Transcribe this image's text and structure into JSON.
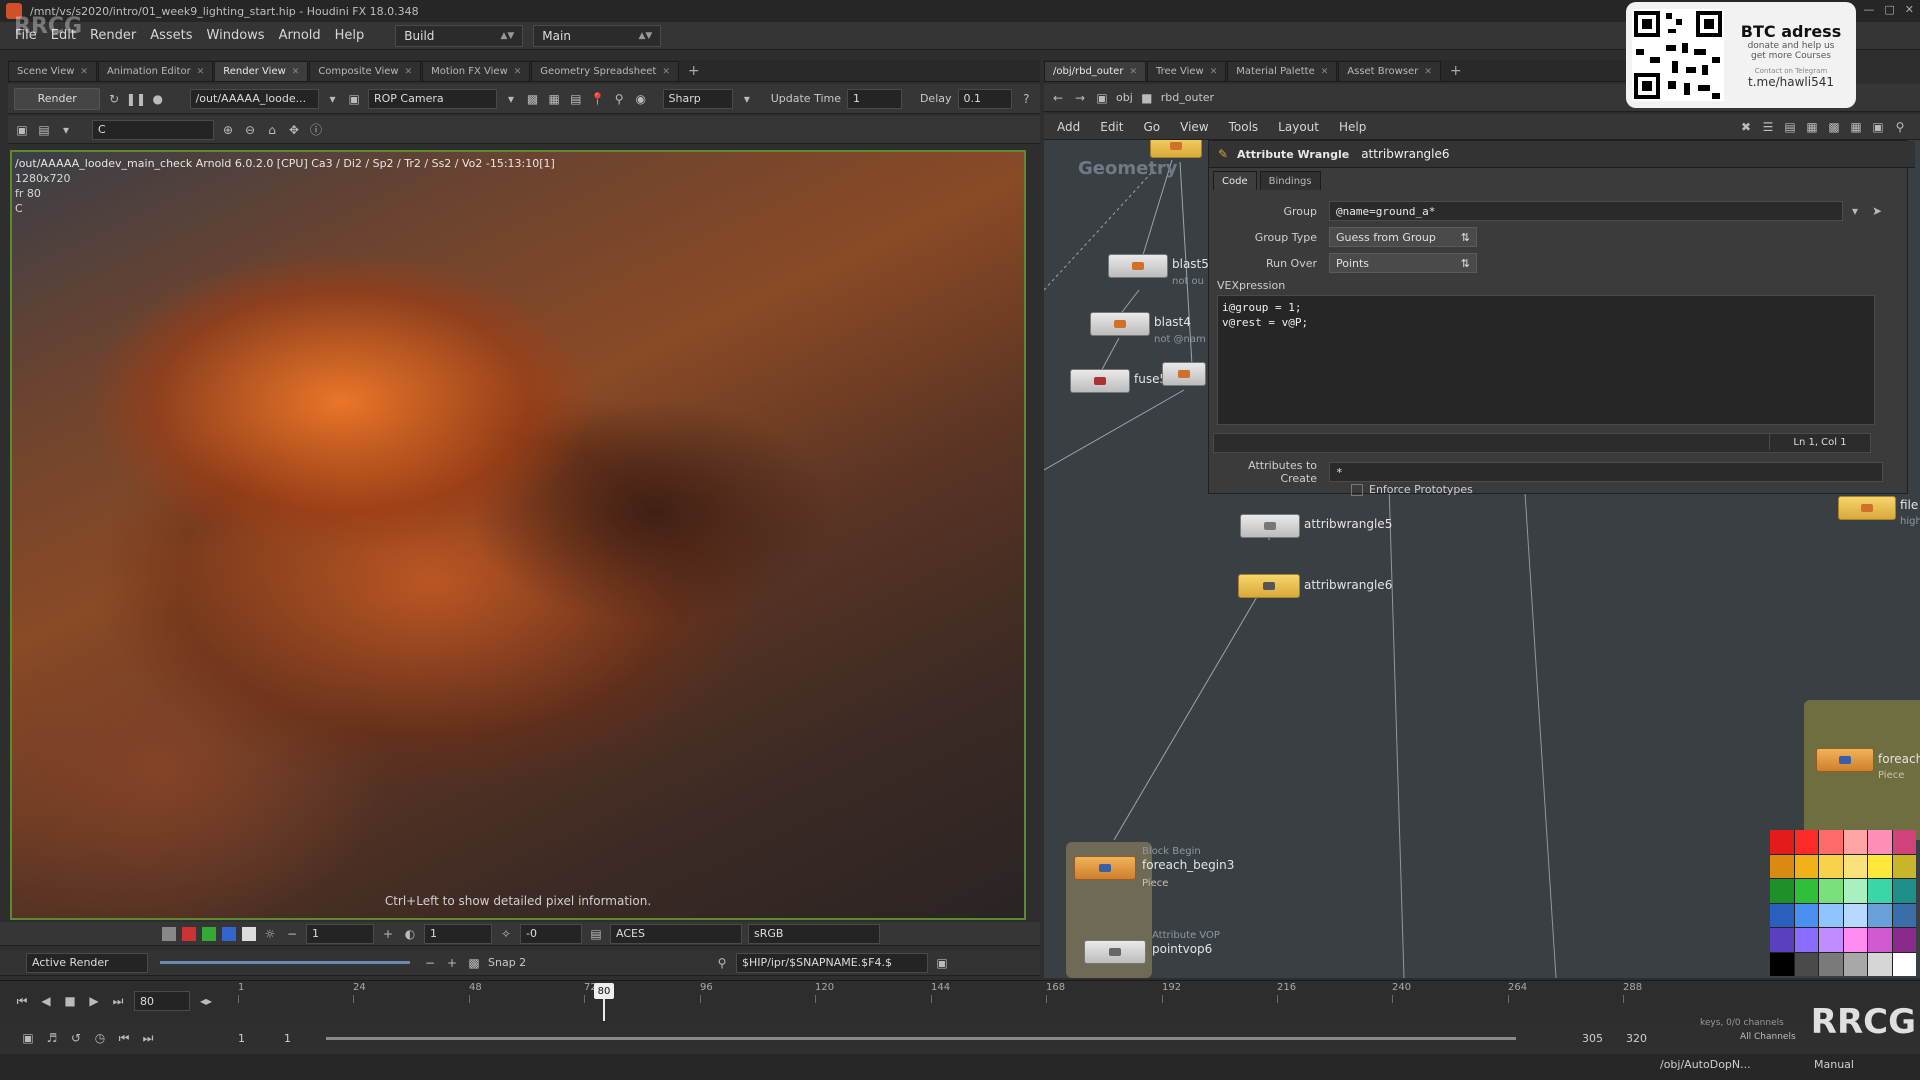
{
  "app": {
    "window_title": "/mnt/vs/s2020/intro/01_week9_lighting_start.hip - Houdini FX 18.0.348",
    "watermark": "RRCG"
  },
  "menubar": {
    "items": [
      "File",
      "Edit",
      "Render",
      "Assets",
      "Windows",
      "Arnold",
      "Help"
    ],
    "shelf_set": "Build",
    "desktop": "Main"
  },
  "left_tabs": [
    "Scene View",
    "Animation Editor",
    "Render View",
    "Composite View",
    "Motion FX View",
    "Geometry Spreadsheet"
  ],
  "left_tabs_active": 2,
  "render_toolbar": {
    "render_label": "Render",
    "output_path": "/out/AAAAA_loode...",
    "camera": "ROP Camera",
    "filter": "Sharp",
    "update_time_label": "Update Time",
    "update_time_value": "1",
    "delay_label": "Delay",
    "delay_value": "0.1"
  },
  "render_toolbar2": {
    "aov": "C"
  },
  "viewport": {
    "header": "/out/AAAAA_loodev_main_check  Arnold 6.0.2.0 [CPU]  Ca3 / Di2 / Sp2 / Tr2 / Ss2 / Vo2 -15:13:10[1]",
    "resolution": "1280x720",
    "frame": "fr 80",
    "channel": "C",
    "hint": "Ctrl+Left to show detailed pixel information."
  },
  "viewport_bar": {
    "exposure": "1",
    "gamma": "1",
    "offset": "-0",
    "ocio": "ACES",
    "display": "sRGB"
  },
  "render_bar": {
    "active_render": "Active Render",
    "snap_label": "Snap 2",
    "snap_path": "$HIP/ipr/$SNAPNAME.$F4.$"
  },
  "right_tabs": [
    "/obj/rbd_outer",
    "Tree View",
    "Material Palette",
    "Asset Browser"
  ],
  "right_tabs_active": 0,
  "net_path": {
    "root": "obj",
    "current": "rbd_outer"
  },
  "net_menu": [
    "Add",
    "Edit",
    "Go",
    "View",
    "Tools",
    "Layout",
    "Help"
  ],
  "params": {
    "node_type": "Attribute Wrangle",
    "node_name": "attribwrangle6",
    "tabs": [
      "Code",
      "Bindings"
    ],
    "group_label": "Group",
    "group_value": "@name=ground_a*",
    "group_type_label": "Group Type",
    "group_type_value": "Guess from Group",
    "run_over_label": "Run Over",
    "run_over_value": "Points",
    "vex_label": "VEXpression",
    "vex_code": "i@group = 1;\nv@rest = v@P;",
    "cursor_pos": "Ln 1, Col 1",
    "attrs_label": "Attributes to Create",
    "attrs_value": "*",
    "enforce_label": "Enforce Prototypes"
  },
  "nodes": {
    "geometry_label": "Geometry",
    "blast5": "blast5",
    "blast5_sub": "not ou",
    "blast4": "blast4",
    "blast4_sub": "not @nam",
    "fuse5": "fuse5",
    "attribwrangle5": "attribwrangle5",
    "attribwrangle6": "attribwrangle6",
    "foreach_begin3": "foreach_begin3",
    "foreach_begin3_tag": "Block Begin",
    "foreach_begin3_sub": "Piece",
    "pointvop6": "pointvop6",
    "pointvop6_tag": "Attribute VOP",
    "foreach_right": "foreach",
    "foreach_right_sub": "Piece",
    "file_right": "file",
    "file_right_sub": "high"
  },
  "banner": {
    "title": "BTC adress",
    "line1": "donate and help us",
    "line2": "get more Courses",
    "line3": "Contact on Telegram",
    "handle": "t.me/hawli541"
  },
  "timeline": {
    "current_frame": "80",
    "frame_field": "80",
    "ticks": [
      "1",
      "24",
      "48",
      "72",
      "96",
      "120",
      "144",
      "168",
      "192",
      "216",
      "240",
      "264",
      "288"
    ],
    "start": "1",
    "start2": "1",
    "end": "305",
    "end2": "320"
  },
  "statusbar": {
    "path": "/obj/AutoDopN...",
    "mode": "Manual",
    "keys_label": "keys, 0/0 channels",
    "all_channels": "All Channels"
  },
  "palette_colors": [
    "#e51b1b",
    "#ff2a2a",
    "#ff6b6b",
    "#ffa5a5",
    "#ff8fb8",
    "#d0437a",
    "#d88a12",
    "#f2b01a",
    "#f7d24a",
    "#f9e27b",
    "#ffe83a",
    "#c9b52a",
    "#1f8f2a",
    "#2fbf3a",
    "#7be07b",
    "#a8f0c0",
    "#3ad6a8",
    "#208f8a",
    "#2a5fbf",
    "#4a8ff2",
    "#8fc4ff",
    "#b8d8ff",
    "#6aa0d8",
    "#3a6ea8",
    "#5a3fbf",
    "#8a6cff",
    "#c08cff",
    "#ff8cf0",
    "#d05ad0",
    "#8a2a8a",
    "#000000",
    "#4a4a4a",
    "#7a7a7a",
    "#a8a8a8",
    "#d6d6d6",
    "#ffffff"
  ]
}
